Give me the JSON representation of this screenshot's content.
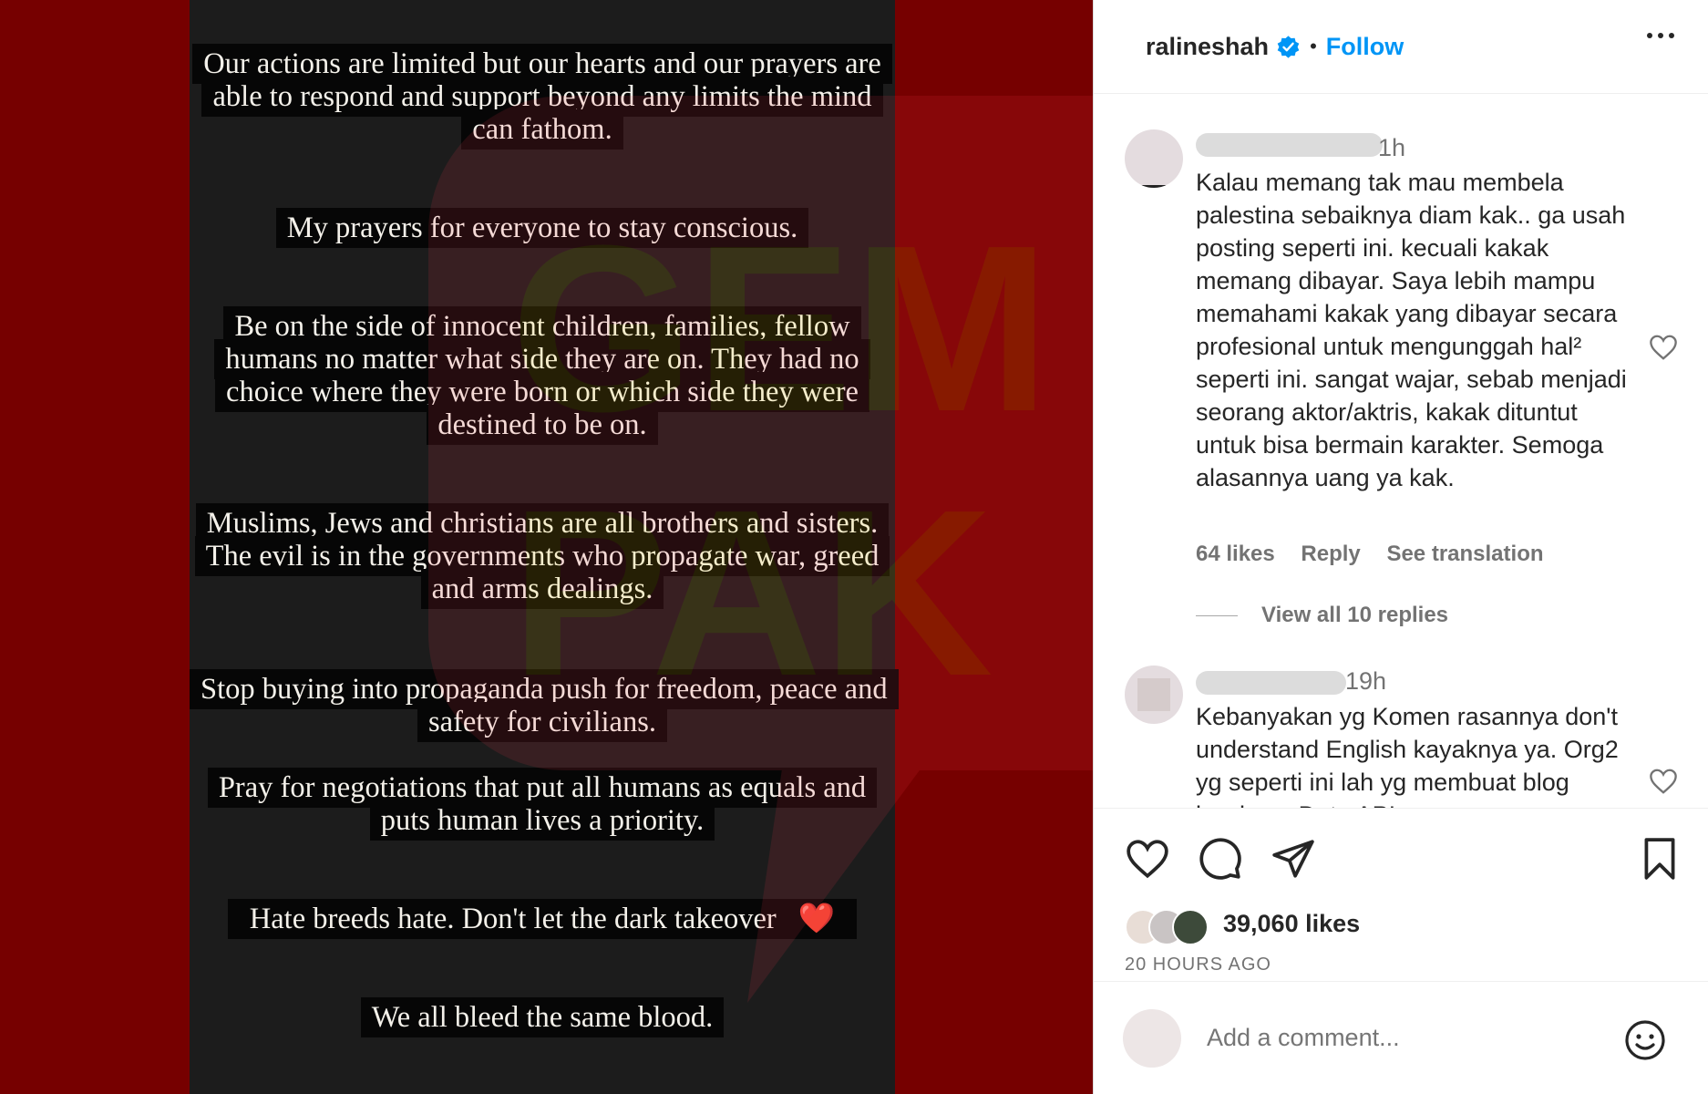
{
  "story": {
    "captions": [
      "Our actions are limited but our hearts and our prayers are able to respond and support beyond any limits the mind can fathom.",
      "My prayers for everyone to stay conscious.",
      "Be on the side of innocent children, families, fellow humans no matter what side they are on. They had no choice where they were born or which side they were destined to be on.",
      "Muslims, Jews and christians are all brothers and sisters. The evil is in the governments who propagate war, greed and arms dealings.",
      "Stop buying into propaganda push for freedom, peace and safety for civilians.",
      "Pray for negotiations that put all humans as equals and puts human lives a priority.",
      "Hate breeds hate. Don't let the dark takeover",
      "We all bleed the same blood."
    ],
    "heart_emoji": "❤️",
    "colors": {
      "background": "#760000",
      "story_bg": "#1c1c1c",
      "caption_bg": "#060606"
    }
  },
  "header": {
    "username": "ralineshah",
    "verified_icon": "verified-badge-icon",
    "separator": "•",
    "follow_label": "Follow",
    "more_icon": "more-options-icon"
  },
  "comments": [
    {
      "time": "1h",
      "text": "Kalau memang tak mau membela palestina sebaiknya diam kak.. ga usah posting seperti ini. kecuali kakak memang dibayar. Saya lebih mampu memahami kakak yang dibayar secara profesional untuk mengunggah hal² seperti ini. sangat wajar, sebab menjadi seorang aktor/aktris, kakak dituntut untuk bisa bermain karakter. Semoga alasannya uang ya kak.",
      "likes": "64 likes",
      "reply_label": "Reply",
      "translation_label": "See translation",
      "view_replies": "View all 10 replies"
    },
    {
      "time": "19h",
      "text": "Kebanyakan yg Komen rasannya don't understand English kayaknya ya. Org2 yg seperti ini lah yg membuat blog berdosa. Duta API"
    }
  ],
  "actions": {
    "like_icon": "heart-icon",
    "comment_icon": "comment-icon",
    "share_icon": "share-icon",
    "save_icon": "bookmark-icon",
    "likes_count": "39,060 likes",
    "posted": "20 HOURS AGO"
  },
  "add_comment": {
    "placeholder": "Add a comment...",
    "emoji_icon": "emoji-icon"
  },
  "colors": {
    "accent": "#0095f6",
    "text": "#262626",
    "muted": "#737373"
  }
}
